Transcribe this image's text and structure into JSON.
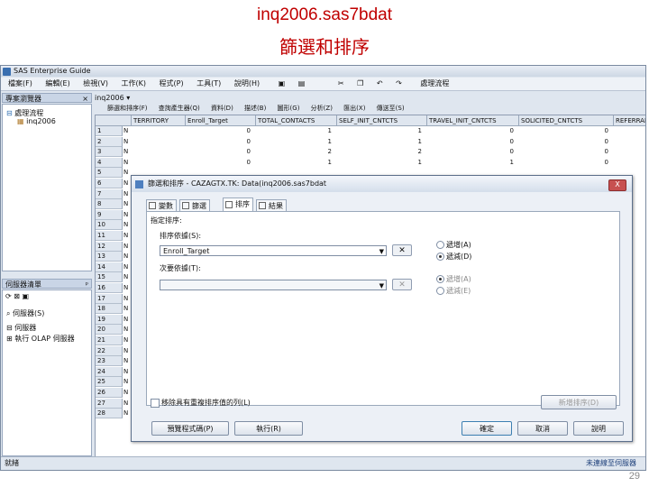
{
  "slide": {
    "title": "inq2006.sas7bdat",
    "subtitle": "篩選和排序",
    "page_number": "29"
  },
  "app": {
    "title": "SAS Enterprise Guide",
    "menu": [
      "檔案(F)",
      "編輯(E)",
      "檢視(V)",
      "工作(K)",
      "程式(P)",
      "工具(T)",
      "說明(H)"
    ],
    "process_flow": "處理流程",
    "project_panel_title": "專案瀏覽器",
    "project_tree": [
      "處理流程",
      "inq2006"
    ],
    "server_panel_title": "伺服器清單",
    "server_toolbar_label": "伺服器(S)",
    "server_tree": [
      "伺服器",
      "執行 OLAP 伺服器"
    ],
    "doc_tab": "inq2006",
    "grid_toolbar": [
      "篩選和排序(F)",
      "查詢產生器(Q)",
      "資料(D)",
      "描述(B)",
      "圖形(G)",
      "分析(Z)",
      "匯出(X)",
      "傳送至(S)"
    ],
    "status_left": "就緒",
    "status_right": "未連線至伺服器",
    "colors": {
      "title_red": "#c00000",
      "window_bg": "#dfe6ef",
      "accent_blue": "#3c7fb1"
    }
  },
  "grid": {
    "columns": [
      "TERRITORY",
      "Enroll_Target",
      "TOTAL_CONTACTS",
      "SELF_INIT_CNTCTS",
      "TRAVEL_INIT_CNTCTS",
      "SOLICITED_CNTCTS",
      "REFERRAL"
    ],
    "row_numbers": [
      "1",
      "2",
      "3",
      "4",
      "5",
      "6",
      "7",
      "8",
      "9",
      "10",
      "11",
      "12",
      "13",
      "14",
      "15",
      "16",
      "17",
      "18",
      "19",
      "20",
      "21",
      "22",
      "23",
      "24",
      "25",
      "26",
      "27",
      "28"
    ],
    "territory_values": [
      "N",
      "N",
      "N",
      "N",
      "N",
      "N",
      "N",
      "N",
      "N",
      "N",
      "N",
      "N",
      "N",
      "N",
      "N",
      "N",
      "N",
      "N",
      "N",
      "N",
      "N",
      "N",
      "N",
      "N",
      "N",
      "N",
      "N",
      "N"
    ],
    "visible_values": [
      {
        "row": 0,
        "col": 1,
        "v": "0"
      },
      {
        "row": 0,
        "col": 2,
        "v": "1"
      },
      {
        "row": 0,
        "col": 3,
        "v": "1"
      },
      {
        "row": 0,
        "col": 4,
        "v": "0"
      },
      {
        "row": 0,
        "col": 5,
        "v": "0"
      },
      {
        "row": 1,
        "col": 1,
        "v": "0"
      },
      {
        "row": 1,
        "col": 2,
        "v": "1"
      },
      {
        "row": 1,
        "col": 3,
        "v": "1"
      },
      {
        "row": 1,
        "col": 4,
        "v": "0"
      },
      {
        "row": 1,
        "col": 5,
        "v": "0"
      },
      {
        "row": 2,
        "col": 1,
        "v": "0"
      },
      {
        "row": 2,
        "col": 2,
        "v": "2"
      },
      {
        "row": 2,
        "col": 3,
        "v": "2"
      },
      {
        "row": 2,
        "col": 4,
        "v": "0"
      },
      {
        "row": 2,
        "col": 5,
        "v": "0"
      },
      {
        "row": 3,
        "col": 1,
        "v": "0"
      },
      {
        "row": 3,
        "col": 2,
        "v": "1"
      },
      {
        "row": 3,
        "col": 3,
        "v": "1"
      },
      {
        "row": 3,
        "col": 4,
        "v": "1"
      },
      {
        "row": 3,
        "col": 5,
        "v": "0"
      }
    ]
  },
  "dialog": {
    "title": "篩選和排序 - CAZAGTX.TK: Data(inq2006.sas7bdat",
    "close_label": "X",
    "tabs": [
      "變數",
      "篩選",
      "排序",
      "結果"
    ],
    "active_tab": 2,
    "section_label": "指定排序:",
    "sort_by_label": "排序依據(S):",
    "sort_by_value": "Enroll_Target",
    "then_by_label": "次要依據(T):",
    "then_by_value": "",
    "sort_order_1": [
      "遞增(A)",
      "遞減(D)"
    ],
    "sort_order_1_selected": 1,
    "sort_order_2": [
      "遞增(A)",
      "遞減(E)"
    ],
    "sort_order_2_selected": 0,
    "remove_label": "✕",
    "checkbox_label": "移除具有重複排序值的列(L)",
    "add_sort_button": "新增排序(D)",
    "preview_button": "預覽程式碼(P)",
    "run_button": "執行(R)",
    "ok_button": "確定",
    "cancel_button": "取消",
    "help_button": "說明"
  }
}
